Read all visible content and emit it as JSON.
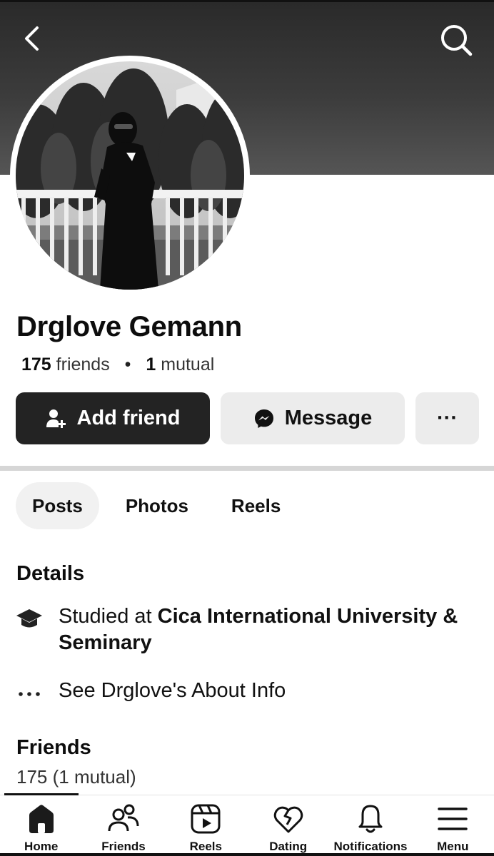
{
  "header": {
    "back_icon": "chevron-left-icon",
    "search_icon": "search-icon"
  },
  "profile": {
    "name": "Drglove Gemann",
    "friends_count": "175",
    "friends_label": "friends",
    "separator": "•",
    "mutual_count": "1",
    "mutual_label": "mutual"
  },
  "actions": {
    "add_friend_label": "Add friend",
    "message_label": "Message",
    "more_label": "···"
  },
  "tabs": [
    {
      "label": "Posts",
      "active": true
    },
    {
      "label": "Photos",
      "active": false
    },
    {
      "label": "Reels",
      "active": false
    }
  ],
  "details": {
    "title": "Details",
    "education_prefix": "Studied at ",
    "education_school": "Cica International University & Seminary",
    "about_label": "See Drglove's About Info"
  },
  "friends": {
    "title": "Friends",
    "count_text": "175 (1 mutual)"
  },
  "bottom_nav": [
    {
      "label": "Home",
      "icon": "home-icon",
      "active": true
    },
    {
      "label": "Friends",
      "icon": "friends-icon",
      "active": false
    },
    {
      "label": "Reels",
      "icon": "reels-icon",
      "active": false
    },
    {
      "label": "Dating",
      "icon": "dating-heart-icon",
      "active": false
    },
    {
      "label": "Notifications",
      "icon": "bell-icon",
      "active": false
    },
    {
      "label": "Menu",
      "icon": "hamburger-menu-icon",
      "active": false
    }
  ]
}
